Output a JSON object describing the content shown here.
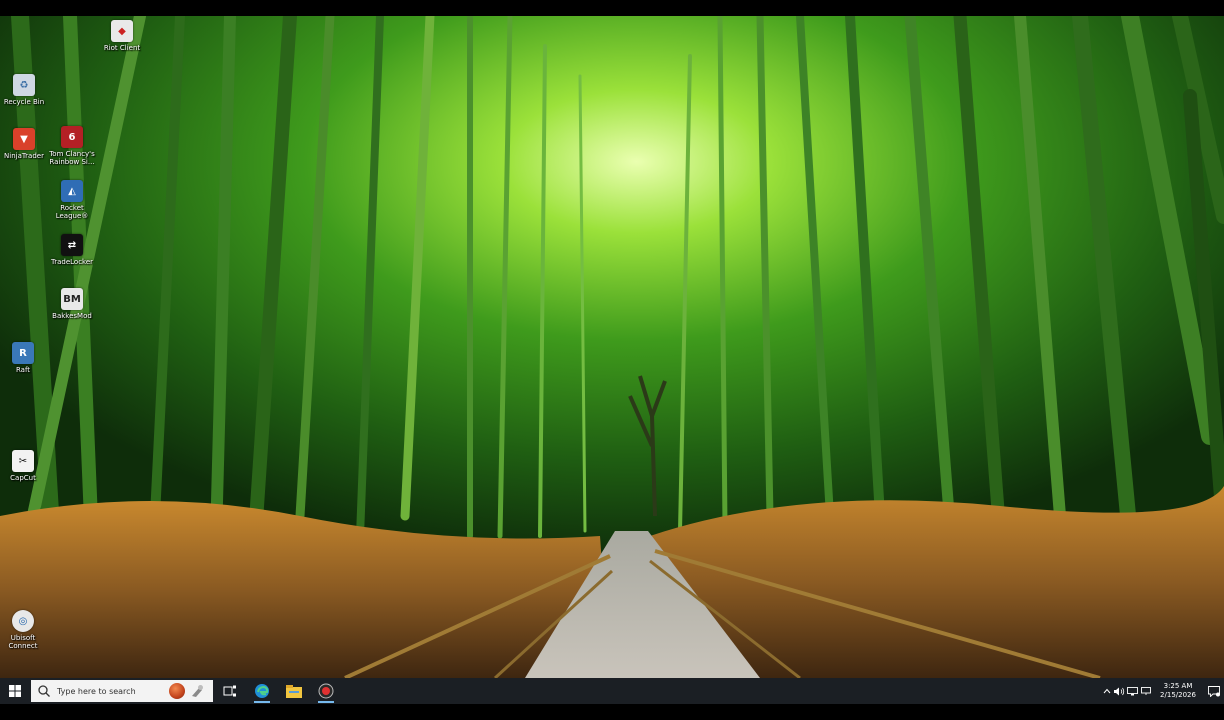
{
  "desktop": {
    "icons": [
      {
        "label": "Riot Client",
        "icon": "riot-client-icon",
        "color": "#e9e9e9"
      },
      {
        "label": "Recycle Bin",
        "icon": "recycle-bin-icon",
        "color": "#cfd8e3"
      },
      {
        "label": "NinjaTrader",
        "icon": "ninjatrader-icon",
        "color": "#d9412a"
      },
      {
        "label": "Tom Clancy's\nRainbow Si...",
        "icon": "rainbow-six-icon",
        "color": "#b32025"
      },
      {
        "label": "Rocket\nLeague®",
        "icon": "rocket-league-icon",
        "color": "#2f6db5"
      },
      {
        "label": "TradeLocker",
        "icon": "tradelocker-icon",
        "color": "#111111"
      },
      {
        "label": "BakkesMod",
        "icon": "bakkesmod-icon",
        "color": "#e8e8e8"
      },
      {
        "label": "Raft",
        "icon": "raft-icon",
        "color": "#3a78b8"
      },
      {
        "label": "CapCut",
        "icon": "capcut-icon",
        "color": "#f2f2f2"
      },
      {
        "label": "Ubisoft\nConnect",
        "icon": "ubisoft-connect-icon",
        "color": "#e8e8e8"
      }
    ]
  },
  "taskbar": {
    "search_placeholder": "Type here to search",
    "pinned": [
      {
        "icon": "task-view-icon"
      },
      {
        "icon": "edge-icon"
      },
      {
        "icon": "file-explorer-icon"
      },
      {
        "icon": "recording-app-icon"
      }
    ],
    "clock_time": "3:25 AM",
    "clock_date": "2/15/2026",
    "accent_color": "#76b9ed"
  }
}
